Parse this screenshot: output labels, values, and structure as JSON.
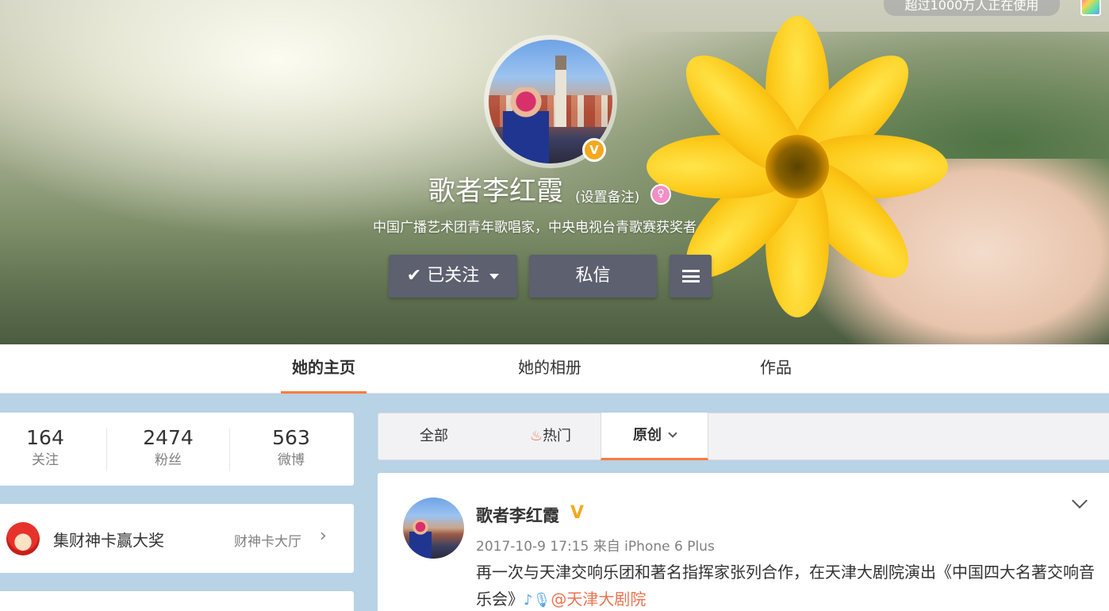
{
  "top_chip": {
    "text": "超过1000万人正在使用"
  },
  "profile": {
    "name": "歌者李红霞",
    "remark_link": "(设置备注)",
    "bio": "中国广播艺术团青年歌唱家，中央电视台青歌赛获奖者",
    "verified": true,
    "gender": "female"
  },
  "actions": {
    "follow_label": "已关注",
    "message_label": "私信"
  },
  "tabs": [
    {
      "label": "她的主页",
      "active": true
    },
    {
      "label": "她的相册",
      "active": false
    },
    {
      "label": "作品",
      "active": false
    }
  ],
  "stats": [
    {
      "value": "164",
      "label": "关注"
    },
    {
      "value": "2474",
      "label": "粉丝"
    },
    {
      "value": "563",
      "label": "微博"
    }
  ],
  "promo": {
    "title": "集财神卡赢大奖",
    "link": "财神卡大厅"
  },
  "filters": [
    {
      "label": "全部",
      "active": false
    },
    {
      "label": "热门",
      "active": false
    },
    {
      "label": "原创",
      "active": true
    }
  ],
  "post": {
    "author": "歌者李红霞",
    "meta": "2017-10-9 17:15 来自 iPhone 6 Plus",
    "text": "再一次与天津交响乐团和著名指挥家张列合作，在天津大剧院演出《中国四大名著交响音乐会》",
    "mention": "@天津大剧院"
  },
  "colors": {
    "accent": "#fa7d3c",
    "button_bg": "#5c606f",
    "verified": "#f4a81e",
    "mention": "#eb7350"
  },
  "icons": [
    "check-icon",
    "caret-down-icon",
    "hamburger-icon",
    "verified-icon",
    "female-icon",
    "flame-icon",
    "chevron-right-icon",
    "chevron-down-icon",
    "music-note-icon",
    "microphone-icon"
  ]
}
